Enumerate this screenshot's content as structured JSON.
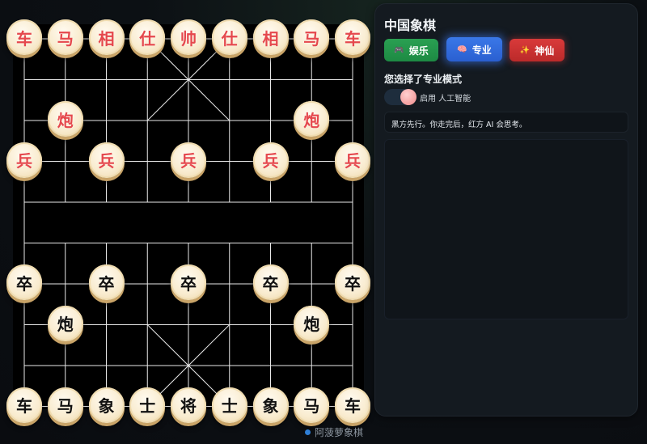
{
  "panel": {
    "title": "中国象棋",
    "modes": [
      {
        "label": "娱乐",
        "icon": "game-controller-icon",
        "glyph": "🎮"
      },
      {
        "label": "专业",
        "icon": "brain-icon",
        "glyph": "🧠"
      },
      {
        "label": "神仙",
        "icon": "sparkle-icon",
        "glyph": "✨"
      }
    ],
    "mode_text": "您选择了专业模式",
    "ai_toggle_label": "启用 人工智能",
    "ai_enabled": true,
    "status": "黑方先行。你走完后，红方 AI 会思考。"
  },
  "credit": "阿菠萝象棋",
  "board": {
    "red_pieces": [
      {
        "label": "车",
        "file": 0,
        "rank": 0
      },
      {
        "label": "马",
        "file": 1,
        "rank": 0
      },
      {
        "label": "相",
        "file": 2,
        "rank": 0
      },
      {
        "label": "仕",
        "file": 3,
        "rank": 0
      },
      {
        "label": "帅",
        "file": 4,
        "rank": 0
      },
      {
        "label": "仕",
        "file": 5,
        "rank": 0
      },
      {
        "label": "相",
        "file": 6,
        "rank": 0
      },
      {
        "label": "马",
        "file": 7,
        "rank": 0
      },
      {
        "label": "车",
        "file": 8,
        "rank": 0
      },
      {
        "label": "炮",
        "file": 1,
        "rank": 2
      },
      {
        "label": "炮",
        "file": 7,
        "rank": 2
      },
      {
        "label": "兵",
        "file": 0,
        "rank": 3
      },
      {
        "label": "兵",
        "file": 2,
        "rank": 3
      },
      {
        "label": "兵",
        "file": 4,
        "rank": 3
      },
      {
        "label": "兵",
        "file": 6,
        "rank": 3
      },
      {
        "label": "兵",
        "file": 8,
        "rank": 3
      }
    ],
    "black_pieces": [
      {
        "label": "卒",
        "file": 0,
        "rank": 6
      },
      {
        "label": "卒",
        "file": 2,
        "rank": 6
      },
      {
        "label": "卒",
        "file": 4,
        "rank": 6
      },
      {
        "label": "卒",
        "file": 6,
        "rank": 6
      },
      {
        "label": "卒",
        "file": 8,
        "rank": 6
      },
      {
        "label": "炮",
        "file": 1,
        "rank": 7
      },
      {
        "label": "炮",
        "file": 7,
        "rank": 7
      },
      {
        "label": "车",
        "file": 0,
        "rank": 9
      },
      {
        "label": "马",
        "file": 1,
        "rank": 9
      },
      {
        "label": "象",
        "file": 2,
        "rank": 9
      },
      {
        "label": "士",
        "file": 3,
        "rank": 9
      },
      {
        "label": "将",
        "file": 4,
        "rank": 9
      },
      {
        "label": "士",
        "file": 5,
        "rank": 9
      },
      {
        "label": "象",
        "file": 6,
        "rank": 9
      },
      {
        "label": "马",
        "file": 7,
        "rank": 9
      },
      {
        "label": "车",
        "file": 8,
        "rank": 9
      }
    ]
  }
}
